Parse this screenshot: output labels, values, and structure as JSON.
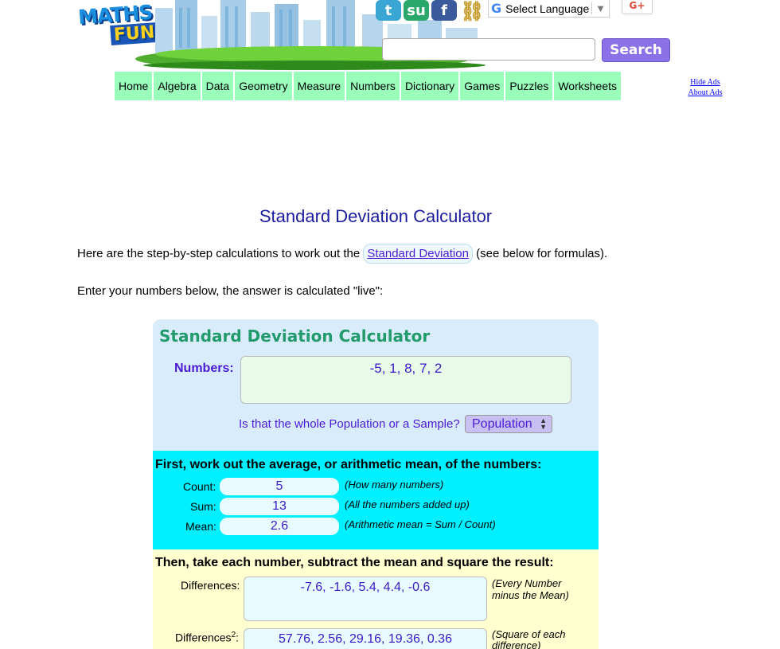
{
  "header": {
    "logo_line1": "MATHS",
    "logo_line2": "FUN",
    "language_label": "Select Language",
    "gplus_label": "G+",
    "search_button": "Search",
    "search_placeholder": ""
  },
  "nav": [
    "Home",
    "Algebra",
    "Data",
    "Geometry",
    "Measure",
    "Numbers",
    "Dictionary",
    "Games",
    "Puzzles",
    "Worksheets"
  ],
  "ads": {
    "hide": "Hide Ads",
    "about": "About Ads"
  },
  "page": {
    "title": "Standard Deviation Calculator",
    "intro_before": "Here are the step-by-step calculations to work out the ",
    "intro_link": "Standard Deviation",
    "intro_after": " (see below for formulas).",
    "enter_text": "Enter your numbers below, the answer is calculated \"live\":"
  },
  "calculator": {
    "title": "Standard Deviation Calculator",
    "numbers_label": "Numbers:",
    "numbers_value": "-5, 1, 8, 7, 2",
    "population_question": "Is that the whole Population or a Sample?",
    "population_value": "Population",
    "step1_heading": "First, work out the average, or arithmetic mean, of the numbers:",
    "count_label": "Count:",
    "count_value": "5",
    "count_note": "(How many numbers)",
    "sum_label": "Sum:",
    "sum_value": "13",
    "sum_note": "(All the numbers added up)",
    "mean_label": "Mean:",
    "mean_value": "2.6",
    "mean_note": "(Arithmetic mean = Sum / Count)",
    "step2_heading": "Then, take each number, subtract the mean and square the result:",
    "diff_label": "Differences:",
    "diff_value": "-7.6, -1.6, 5.4, 4.4, -0.6",
    "diff_note_1": "(Every Number",
    "diff_note_2": "minus the Mean)",
    "diff2_label": "Differences",
    "diff2_sup": "2",
    "diff2_colon": ":",
    "diff2_value": "57.76, 2.56, 29.16, 19.36, 0.36",
    "diff2_note_1": "(Square of each",
    "diff2_note_2": "difference)"
  }
}
